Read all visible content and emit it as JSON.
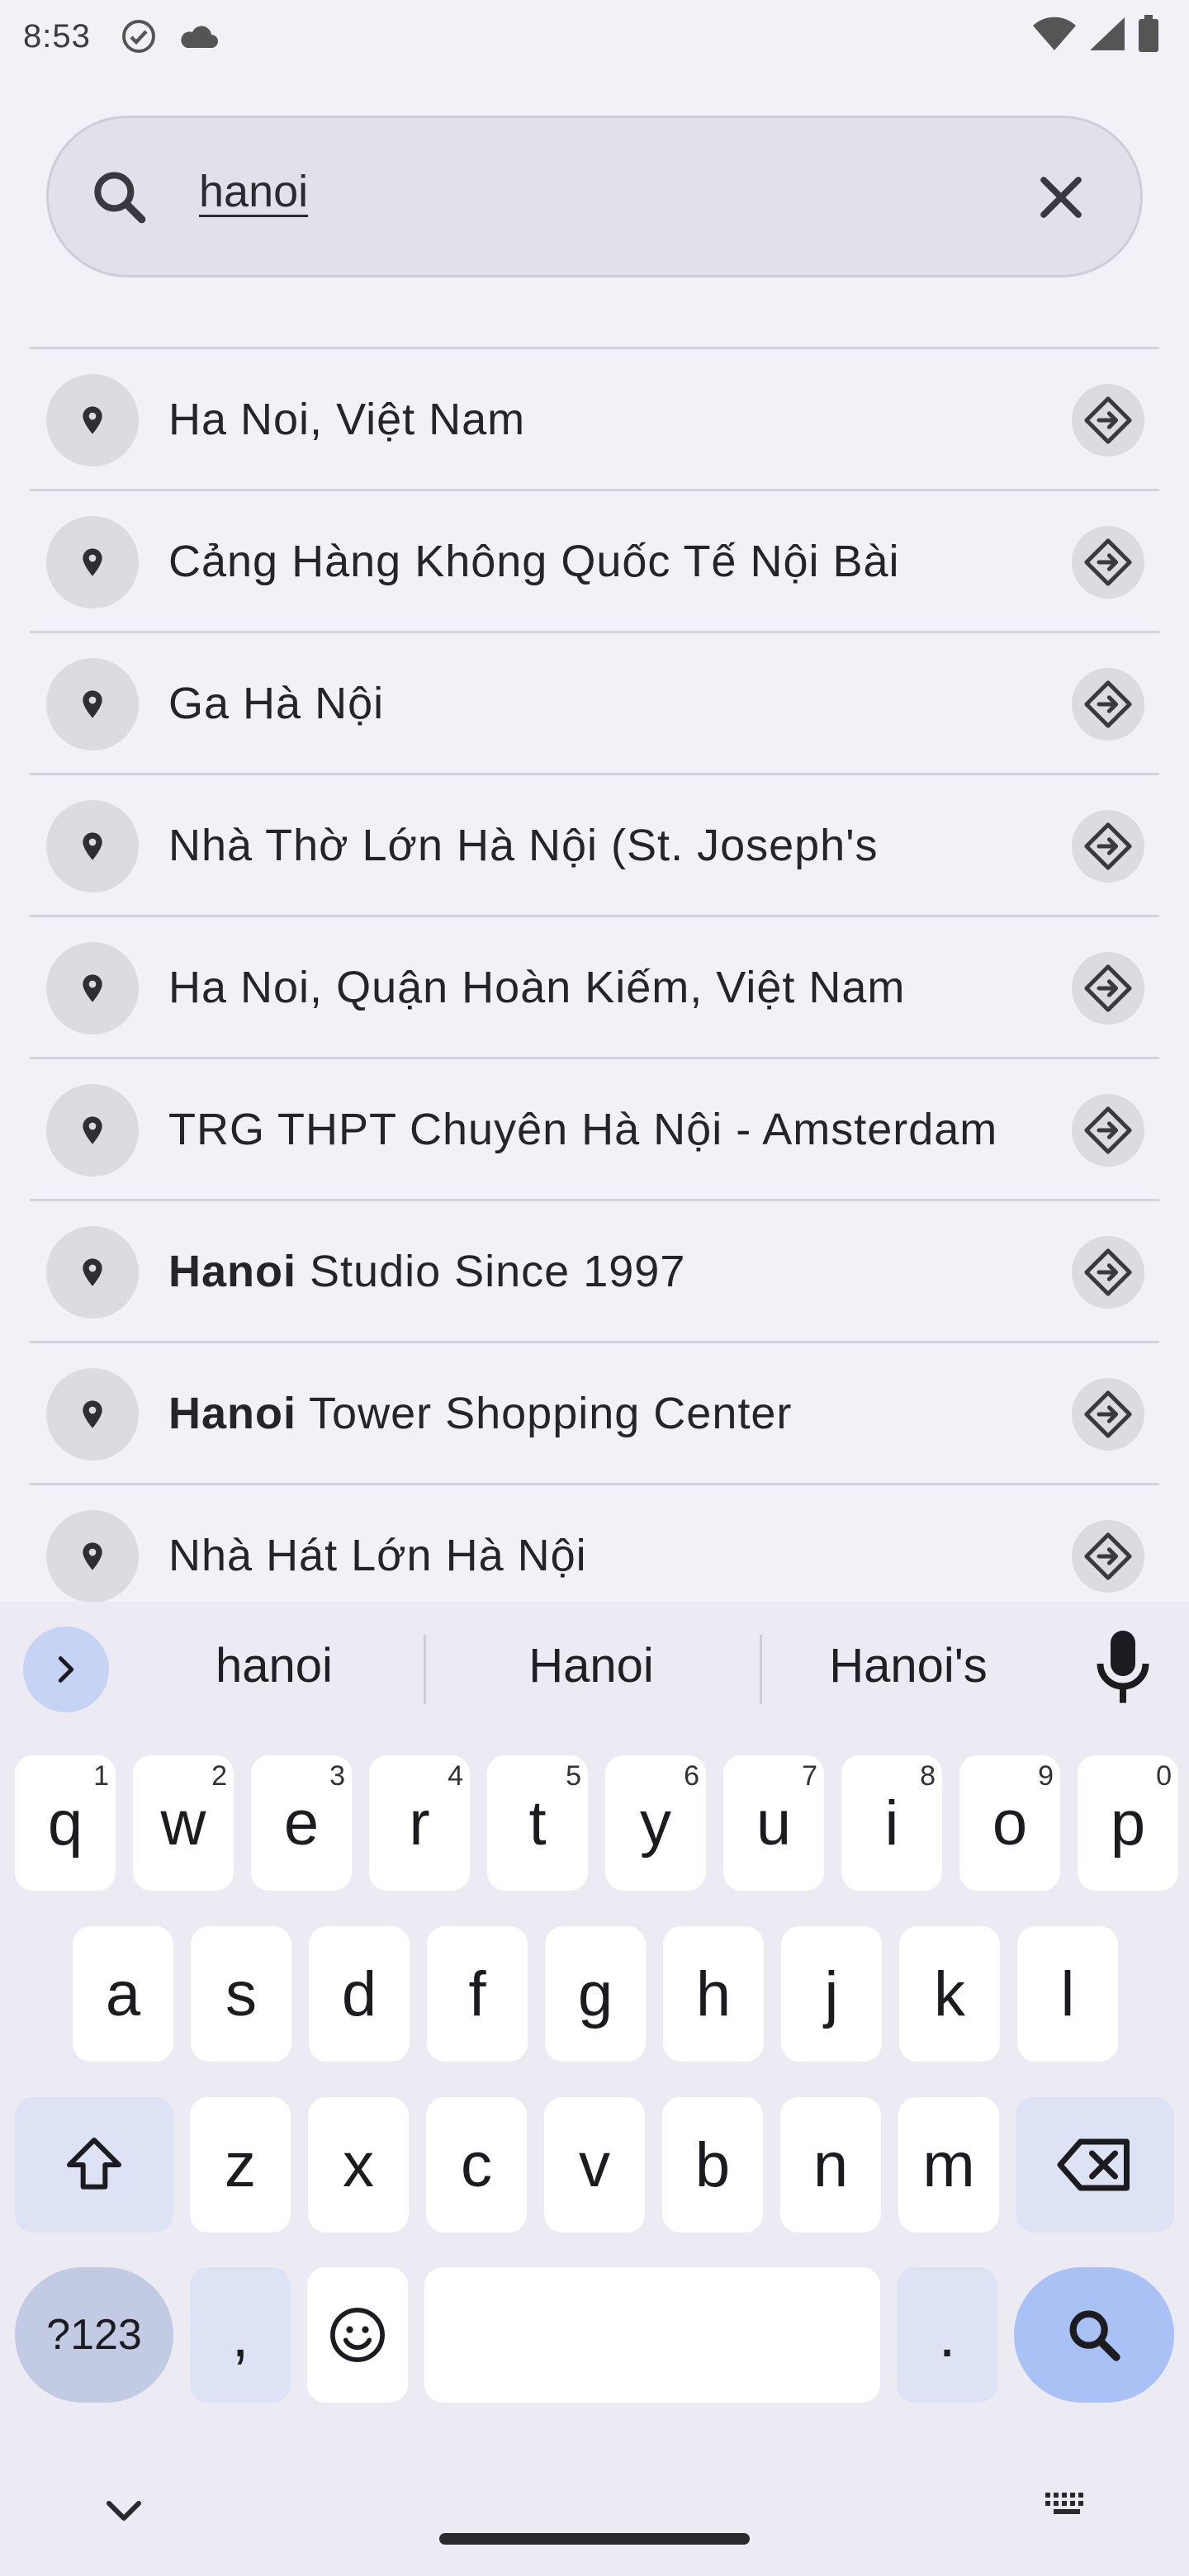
{
  "status_bar": {
    "time": "8:53",
    "icons": [
      "check-circle-icon",
      "cloud-icon",
      "wifi-icon",
      "signal-icon",
      "battery-icon"
    ]
  },
  "search": {
    "query": "hanoi",
    "leading_icon": "search-icon",
    "trailing_icon": "close-icon"
  },
  "results": [
    {
      "bold": "",
      "text": "Ha Noi, Việt Nam"
    },
    {
      "bold": "",
      "text": "Cảng Hàng Không Quốc Tế Nội Bài"
    },
    {
      "bold": "",
      "text": "Ga Hà Nội"
    },
    {
      "bold": "",
      "text": "Nhà Thờ Lớn Hà Nội (St. Joseph's"
    },
    {
      "bold": "",
      "text": "Ha Noi, Quận Hoàn Kiếm, Việt Nam"
    },
    {
      "bold": "",
      "text": "TRG THPT Chuyên Hà Nội - Amsterdam"
    },
    {
      "bold": "Hanoi",
      "text": " Studio Since 1997"
    },
    {
      "bold": "Hanoi",
      "text": " Tower Shopping Center"
    },
    {
      "bold": "",
      "text": "Nhà Hát Lớn Hà Nội"
    }
  ],
  "keyboard": {
    "suggestions": [
      "hanoi",
      "Hanoi",
      "Hanoi's"
    ],
    "row1": [
      {
        "k": "q",
        "h": "1"
      },
      {
        "k": "w",
        "h": "2"
      },
      {
        "k": "e",
        "h": "3"
      },
      {
        "k": "r",
        "h": "4"
      },
      {
        "k": "t",
        "h": "5"
      },
      {
        "k": "y",
        "h": "6"
      },
      {
        "k": "u",
        "h": "7"
      },
      {
        "k": "i",
        "h": "8"
      },
      {
        "k": "o",
        "h": "9"
      },
      {
        "k": "p",
        "h": "0"
      }
    ],
    "row2": [
      "a",
      "s",
      "d",
      "f",
      "g",
      "h",
      "j",
      "k",
      "l"
    ],
    "row3": [
      "z",
      "x",
      "c",
      "v",
      "b",
      "n",
      "m"
    ],
    "sym_label": "?123",
    "comma": ",",
    "period": "."
  },
  "colors": {
    "accent": "#a9c1f5",
    "background": "#f2f1f7",
    "search_fill": "#e2e1ea"
  }
}
